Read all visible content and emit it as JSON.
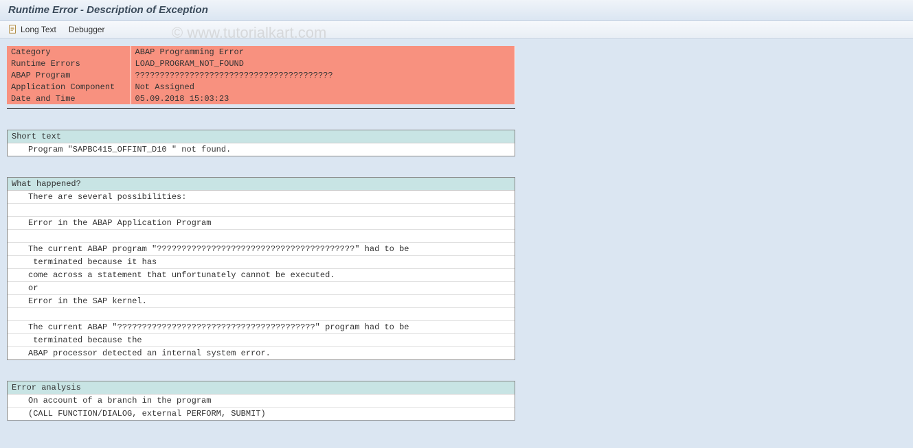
{
  "title": "Runtime Error - Description of Exception",
  "toolbar": {
    "long_text": "Long Text",
    "debugger": "Debugger"
  },
  "info": {
    "rows": [
      {
        "label": "Category",
        "value": "ABAP Programming Error"
      },
      {
        "label": "Runtime Errors",
        "value": "LOAD_PROGRAM_NOT_FOUND"
      },
      {
        "label": "ABAP Program",
        "value": "????????????????????????????????????????"
      },
      {
        "label": "Application Component",
        "value": "Not Assigned"
      },
      {
        "label": "Date and Time",
        "value": "05.09.2018 15:03:23"
      }
    ]
  },
  "sections": [
    {
      "header": "Short text",
      "lines": [
        "Program \"SAPBC415_OFFINT_D10 \" not found."
      ]
    },
    {
      "header": "What happened?",
      "lines": [
        "There are several possibilities:",
        "",
        "Error in the ABAP Application Program",
        "",
        "The current ABAP program \"????????????????????????????????????????\" had to be",
        " terminated because it has",
        "come across a statement that unfortunately cannot be executed.",
        "or",
        "Error in the SAP kernel.",
        "",
        "The current ABAP \"????????????????????????????????????????\" program had to be",
        " terminated because the",
        "ABAP processor detected an internal system error."
      ]
    },
    {
      "header": "Error analysis",
      "lines": [
        "On account of a branch in the program",
        "(CALL FUNCTION/DIALOG, external PERFORM, SUBMIT)"
      ]
    }
  ],
  "watermark": "© www.tutorialkart.com"
}
